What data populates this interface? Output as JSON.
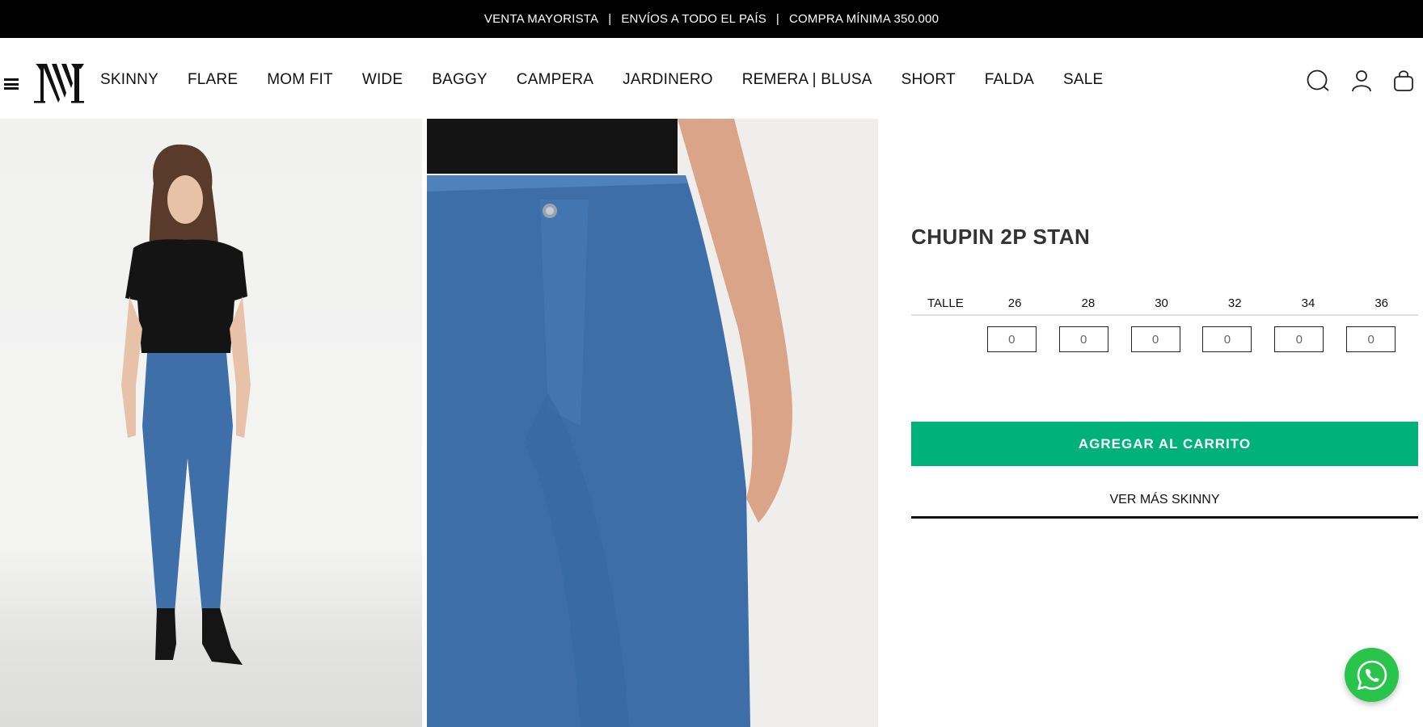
{
  "announcement": {
    "items": [
      "VENTA MAYORISTA",
      "ENVÍOS A TODO EL PAÍS",
      "COMPRA MÍNIMA 350.000"
    ],
    "separator": "|"
  },
  "header": {
    "logo_icon": "mv-monogram-logo",
    "nav": [
      "SKINNY",
      "FLARE",
      "MOM FIT",
      "WIDE",
      "BAGGY",
      "CAMPERA",
      "JARDINERO",
      "REMERA | BLUSA",
      "SHORT",
      "FALDA",
      "SALE"
    ],
    "icons": [
      "search-icon",
      "user-icon",
      "bag-icon"
    ]
  },
  "product": {
    "title": "CHUPIN 2P STAN",
    "size_label": "TALLE",
    "sizes": [
      "26",
      "28",
      "30",
      "32",
      "34",
      "36"
    ],
    "quantities": [
      "0",
      "0",
      "0",
      "0",
      "0",
      "0"
    ],
    "add_to_cart_label": "AGREGAR AL CARRITO",
    "see_more_label": "VER MÁS SKINNY",
    "accent_color": "#00b27a"
  },
  "whatsapp": {
    "icon": "whatsapp-icon",
    "color": "#29c54a"
  }
}
